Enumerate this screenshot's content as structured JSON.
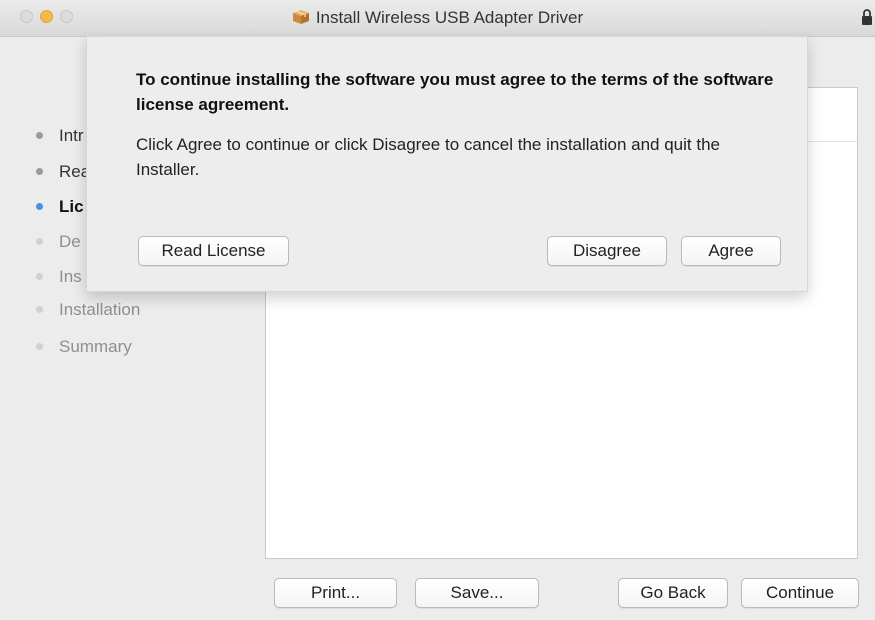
{
  "window": {
    "title": "Install Wireless USB Adapter Driver"
  },
  "sidebar": {
    "steps": [
      {
        "label": "Intr",
        "state": "done"
      },
      {
        "label": "Rea",
        "state": "done"
      },
      {
        "label": "Lic",
        "state": "current"
      },
      {
        "label": "De",
        "state": "pending"
      },
      {
        "label": "Ins",
        "state": "pending"
      },
      {
        "label": "Installation",
        "state": "pending"
      },
      {
        "label": "Summary",
        "state": "pending"
      }
    ]
  },
  "sheet": {
    "heading": "To continue installing the software you must agree to the terms of the software license agreement.",
    "body": "Click Agree to continue or click Disagree to cancel the installation and quit the Installer.",
    "read_license_label": "Read License",
    "disagree_label": "Disagree",
    "agree_label": "Agree"
  },
  "footer": {
    "print_label": "Print...",
    "save_label": "Save...",
    "go_back_label": "Go Back",
    "continue_label": "Continue"
  },
  "colors": {
    "current_step": "#4a90e2",
    "minimize_button": "#f5b94a"
  },
  "icons": {
    "title": "package-icon",
    "lock": "lock-icon"
  }
}
